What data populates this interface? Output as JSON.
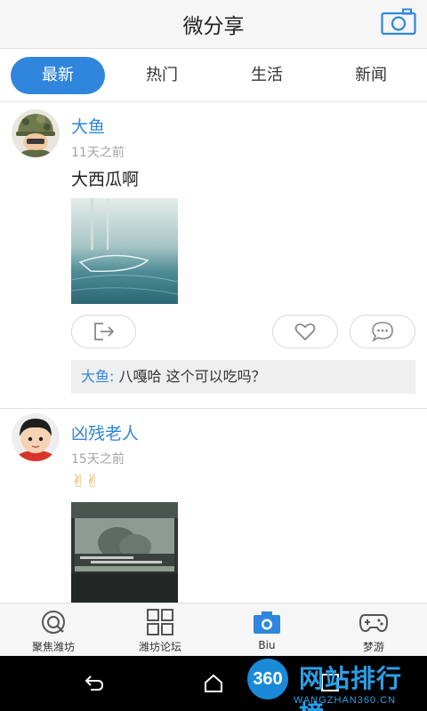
{
  "app": {
    "title": "微分享"
  },
  "tabs": [
    {
      "label": "最新",
      "active": true
    },
    {
      "label": "热门",
      "active": false
    },
    {
      "label": "生活",
      "active": false
    },
    {
      "label": "新闻",
      "active": false
    }
  ],
  "posts": [
    {
      "author": "大鱼",
      "time": "11天之前",
      "content": "大西瓜啊",
      "avatar_icon": "soldier-avatar",
      "comment": {
        "author": "大鱼:",
        "text": " 八嘎哈 这个可以吃吗？"
      }
    },
    {
      "author": "凶残老人",
      "time": "15天之前",
      "content": "✌✌",
      "avatar_icon": "boy-avatar"
    }
  ],
  "bottom_nav": [
    {
      "label": "聚焦潍坊",
      "icon": "focus-icon"
    },
    {
      "label": "潍坊论坛",
      "icon": "grid-icon"
    },
    {
      "label": "Biu",
      "icon": "camera-icon",
      "active": true
    },
    {
      "label": "梦游",
      "icon": "gamepad-icon"
    }
  ],
  "watermark": {
    "badge": "360",
    "title": "网站排行榜",
    "url": "WANGZHAN360.CN"
  },
  "colors": {
    "accent": "#2f86dc",
    "muted": "#a3a3a3",
    "comment_bg": "#efefef"
  }
}
